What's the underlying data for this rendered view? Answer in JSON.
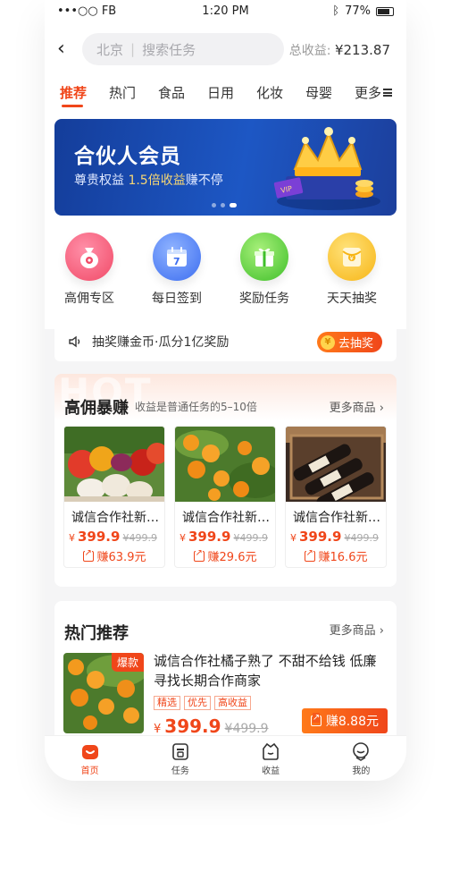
{
  "status_bar": {
    "carrier": "•••○○ FB",
    "time": "1:20 PM",
    "battery": "77%"
  },
  "header": {
    "city": "北京",
    "search_placeholder": "搜索任务",
    "earnings_label": "总收益:",
    "earnings_value": "¥213.87"
  },
  "tabs": [
    {
      "label": "推荐",
      "active": true
    },
    {
      "label": "热门"
    },
    {
      "label": "食品"
    },
    {
      "label": "日用"
    },
    {
      "label": "化妆"
    },
    {
      "label": "母婴"
    },
    {
      "label": "更多"
    }
  ],
  "banner": {
    "title": "合伙人会员",
    "subtitle_prefix": "尊贵权益 ",
    "subtitle_highlight": "1.5倍收益",
    "subtitle_suffix": "赚不停",
    "page_count": 3,
    "active_page": 3
  },
  "quick_actions": [
    {
      "label": "高佣专区",
      "icon": "money-bag-icon"
    },
    {
      "label": "每日签到",
      "icon": "calendar-icon",
      "icon_text": "7"
    },
    {
      "label": "奖励任务",
      "icon": "gift-icon"
    },
    {
      "label": "天天抽奖",
      "icon": "red-envelope-icon"
    }
  ],
  "notice": {
    "text": "抽奖赚金币·瓜分1亿奖励",
    "button": "去抽奖",
    "coin": "¥"
  },
  "high_commission": {
    "watermark": "HOT",
    "title": "高佣暴赚",
    "subtitle": "收益是普通任务的5–10倍",
    "more": "更多商品",
    "products": [
      {
        "name": "诚信合作社新…",
        "yen": "¥",
        "price": "399.9",
        "old_price": "¥499.9",
        "earn": "赚63.9元"
      },
      {
        "name": "诚信合作社新…",
        "yen": "¥",
        "price": "399.9",
        "old_price": "¥499.9",
        "earn": "赚29.6元"
      },
      {
        "name": "诚信合作社新…",
        "yen": "¥",
        "price": "399.9",
        "old_price": "¥499.9",
        "earn": "赚16.6元"
      }
    ]
  },
  "hot_recommend": {
    "title": "热门推荐",
    "more": "更多商品",
    "badge": "爆款",
    "product_title": "诚信合作社橘子熟了 不甜不给钱 低廉 寻找长期合作商家",
    "tags": [
      "精选",
      "优先",
      "高收益"
    ],
    "yen": "¥",
    "price": "399.9",
    "old_price": "¥499.9",
    "earn": "赚8.88元"
  },
  "bottom_nav": [
    {
      "label": "首页",
      "active": true
    },
    {
      "label": "任务"
    },
    {
      "label": "收益"
    },
    {
      "label": "我的"
    }
  ],
  "colors": {
    "accent": "#f0461a",
    "banner": "#1d57c4",
    "background": "#f5f5f6"
  }
}
